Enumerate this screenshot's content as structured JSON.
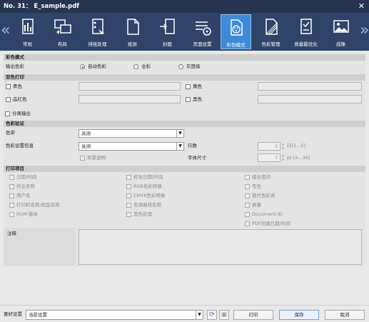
{
  "window": {
    "title": "No. 31： E_sample.pdf",
    "close_glyph": "✕"
  },
  "toolbar": {
    "prev_glyph": "«",
    "next_glyph": "»",
    "tabs": [
      {
        "label": "常规",
        "icon": "general-icon"
      },
      {
        "label": "布局",
        "icon": "layout-icon"
      },
      {
        "label": "排纸处理",
        "icon": "finishing-icon"
      },
      {
        "label": "纸张",
        "icon": "paper-icon"
      },
      {
        "label": "封面",
        "icon": "cover-icon"
      },
      {
        "label": "页面设置",
        "icon": "page-setup-icon"
      },
      {
        "label": "彩色模式",
        "icon": "color-mode-icon",
        "active": true
      },
      {
        "label": "色彩管理",
        "icon": "color-management-icon"
      },
      {
        "label": "质量最优化",
        "icon": "quality-icon"
      },
      {
        "label": "成像",
        "icon": "imaging-icon"
      }
    ]
  },
  "color_mode": {
    "section_title": "彩色模式",
    "output_label": "输出色彩",
    "options": [
      "自动色彩",
      "全彩",
      "灰度级"
    ],
    "selected": "自动色彩"
  },
  "two_color": {
    "section_title": "双色打印",
    "items": [
      "青色",
      "黄色",
      "品红色",
      "黑色"
    ]
  },
  "separation": {
    "label": "分离输出"
  },
  "color_verify": {
    "section_title": "色彩验证",
    "band_label": "色带",
    "band_value": "关闭",
    "info_label": "色彩设置信息",
    "info_value": "关闭",
    "rows_label": "行数",
    "rows_value": "3",
    "rows_unit": "行[1...5]",
    "font_label": "字体尺寸",
    "font_value": "7",
    "font_unit": "pt [4...36]",
    "bg_transparent": "背景透明"
  },
  "print_items": {
    "section_title": "打印项目",
    "col1": [
      "日期/时间",
      "作业名称",
      "用户名",
      "打印机名称/机型名称",
      "ROM 版本"
    ],
    "col2": [
      "校准日期/时间",
      "RGB色彩转换",
      "CMYK色彩转换",
      "色调曲线名称",
      "黑色处理"
    ],
    "col3": [
      "组合套印",
      "专色",
      "替代色彩表",
      "屏幕",
      "Document ID",
      "PDF创建日期/时间"
    ]
  },
  "note": {
    "label": "注释"
  },
  "bottom": {
    "preset_label": "喜好设置",
    "preset_value": "当前设置",
    "print": "打印",
    "save": "保存",
    "cancel": "取消"
  }
}
